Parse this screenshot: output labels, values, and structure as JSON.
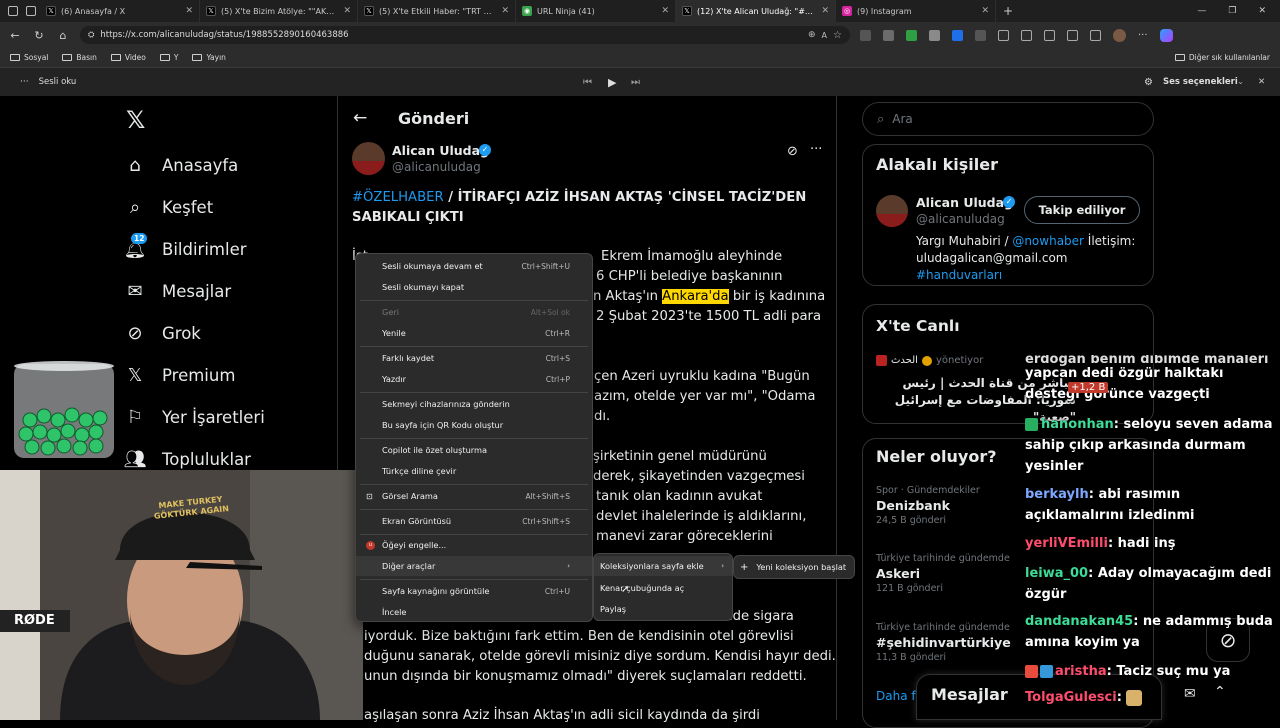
{
  "browser": {
    "tabs": [
      {
        "icon": "x-logo-icon",
        "title": "(6) Anasayfa / X"
      },
      {
        "icon": "x-logo-icon",
        "title": "(5) X'te Bizim Atölye: \"\"AKP ve MHP"
      },
      {
        "icon": "x-logo-icon",
        "title": "(5) X'te Etkili Haber: \"TRT Haber, İ"
      },
      {
        "icon": "url-ninja-icon",
        "title": "URL Ninja (41)"
      },
      {
        "icon": "x-logo-icon",
        "title": "(12) X'te Alican Uludağ: \"#ÖZELH"
      },
      {
        "icon": "instagram-icon",
        "title": "(9) Instagram"
      }
    ],
    "active_tab": 4,
    "url": "https://x.com/alicanuludag/status/1988552890160463886",
    "bookmarks": [
      "Sosyal",
      "Basın",
      "Video",
      "Y",
      "Yayın"
    ],
    "other_bookmarks": "Diğer sık kullanılanlar",
    "read_aloud": {
      "label": "Sesli oku",
      "options": "Ses seçenekleri"
    }
  },
  "nav": {
    "items": [
      {
        "icon": "home-icon",
        "label": "Anasayfa"
      },
      {
        "icon": "search-icon",
        "label": "Keşfet"
      },
      {
        "icon": "bell-icon",
        "label": "Bildirimler",
        "badge": "12"
      },
      {
        "icon": "mail-icon",
        "label": "Mesajlar"
      },
      {
        "icon": "grok-icon",
        "label": "Grok"
      },
      {
        "icon": "x-logo-icon",
        "label": "Premium"
      },
      {
        "icon": "bookmark-icon",
        "label": "Yer İşaretleri"
      },
      {
        "icon": "people-icon",
        "label": "Topluluklar"
      }
    ]
  },
  "post": {
    "header": "Gönderi",
    "author_name": "Alican Uludağ",
    "author_handle": "@alicanuludag",
    "hashtag": "#ÖZELHABER",
    "headline": " / İTİRAFÇI AZİZ İHSAN AKTAŞ 'CİNSEL TACİZ'DEN SABIKALI ÇIKTI",
    "p1_frag1": "İst...",
    "p1_l1": "Ekrem İmamoğlu aleyhinde",
    "p1_l2": "6 CHP'li belediye başkanının",
    "p1_l3a": "n Aktaş'ın ",
    "p1_l3hl": "Ankara'da",
    "p1_l3b": " bir iş kadınına",
    "p1_l4": "2 Şubat 2023'te 1500 TL adli para",
    "p2_l1": "çen Azeri uyruklu kadına \"Bugün",
    "p2_l2": "azım, otelde yer var mı\", \"Odama",
    "p2_l3": "dı.",
    "p3_l1": "şirketinin genel müdürünü",
    "p3_l2": "derek, şikayetinden vazgeçmesi",
    "p3_l3": "tanık olan kadının avukat",
    "p3_l4": "devlet ihalelerinde iş aldıklarını,",
    "p3_l5": "manevi zarar göreceklerini",
    "p4_l1": "Otel önünde sigara",
    "p4_l2": "iyorduk. Bize baktığını fark ettim. Ben de kendisinin otel görevlisi",
    "p4_l3": "duğunu sanarak, otelde görevli misiniz diye sordum. Kendisi hayır dedi.",
    "p4_l4": "unun dışında bir konuşmamız olmadı\" diyerek suçlamaları reddetti.",
    "p5_l1": "aşılaşan sonra Aziz İhsan Aktaş'ın adli sicil kaydında da şirdi"
  },
  "right": {
    "search_placeholder": "Ara",
    "related_title": "Alakalı kişiler",
    "rel_name": "Alican Uludağ",
    "rel_handle": "@alicanuludag",
    "follow_label": "Takip ediliyor",
    "bio_pre": "Yargı Muhabiri / ",
    "bio_link": "@nowhaber",
    "bio_mid": " İletişim:",
    "bio_email": "uludagalican@gmail.com",
    "bio_tag": "#handuvarları",
    "live_title": "X'te Canlı",
    "live_host": "الحدث",
    "live_role": "yönetiyor",
    "live_text": "مباشر من قناة الحدث | رئيس سوريا: المفاوضات مع إسرائيل \"صعبة\"",
    "trends_title": "Neler oluyor?",
    "trends": [
      {
        "cat": "Spor · Gündemdekiler",
        "name": "Denizbank",
        "count": "24,5 B gönderi"
      },
      {
        "cat": "Türkiye tarihinde gündemde",
        "name": "Askeri",
        "count": "121 B gönderi"
      },
      {
        "cat": "Türkiye tarihinde gündemde",
        "name": "#şehidinvartürkiye",
        "count": "11,3 B gönderi"
      }
    ],
    "more": "Daha fa",
    "messages": "Mesajlar"
  },
  "chat": [
    {
      "user": "",
      "text": "erdoğan benim dibimde manaleri"
    },
    {
      "user": "",
      "text": "yapcan dedi özgür halktakı desteği görünce vazgeçti"
    },
    {
      "user": "hanonhan",
      "text": " seloyu seven adama sahip çıkıp arkasında durmam yesinler"
    },
    {
      "user": "berkaylh",
      "text": " abi rasımın açıklamalırını izledinmi"
    },
    {
      "user": "yerliVEmilli",
      "text": " hadi inş"
    },
    {
      "user": "leiwa_00",
      "text": " Aday olmayacağım dedi özgür"
    },
    {
      "user": "dandanakan45",
      "text": " ne adammış buda amına koyim ya"
    },
    {
      "user": "aristha",
      "text": " Taciz suç mu ya"
    },
    {
      "user": "TolgaGulesci",
      "text": ""
    }
  ],
  "chat_overlay_count": "+1,2 B",
  "context_menu": {
    "items": [
      {
        "label": "Sesli okumaya devam et",
        "shortcut": "Ctrl+Shift+U"
      },
      {
        "label": "Sesli okumayı kapat",
        "shortcut": ""
      },
      {
        "label": "Geri",
        "shortcut": "Alt+Sol ok",
        "disabled": true
      },
      {
        "label": "Yenile",
        "shortcut": "Ctrl+R"
      },
      {
        "label": "Farklı kaydet",
        "shortcut": "Ctrl+S"
      },
      {
        "label": "Yazdır",
        "shortcut": "Ctrl+P"
      },
      {
        "label": "Sekmeyi cihazlarınıza gönderin",
        "shortcut": ""
      },
      {
        "label": "Bu sayfa için QR Kodu oluştur",
        "shortcut": ""
      },
      {
        "label": "Copilot ile özet oluşturma",
        "shortcut": ""
      },
      {
        "label": "Türkçe diline çevir",
        "shortcut": ""
      },
      {
        "label": "Görsel Arama",
        "shortcut": "Alt+Shift+S"
      },
      {
        "label": "Ekran Görüntüsü",
        "shortcut": "Ctrl+Shift+S"
      },
      {
        "label": "Öğeyi engelle...",
        "shortcut": ""
      },
      {
        "label": "Diğer araçlar",
        "shortcut": ""
      },
      {
        "label": "Sayfa kaynağını görüntüle",
        "shortcut": "Ctrl+U"
      },
      {
        "label": "İncele",
        "shortcut": ""
      }
    ],
    "submenu": [
      "Koleksiyonlara sayfa ekle",
      "Kenar çubuğunda aç",
      "Paylaş"
    ],
    "submenu2": "Yeni koleksiyon başlat"
  },
  "webcam": {
    "mic_brand": "RØDE",
    "hat_text": "MAKE TURKEY GÖKTÜRK AGAIN"
  }
}
